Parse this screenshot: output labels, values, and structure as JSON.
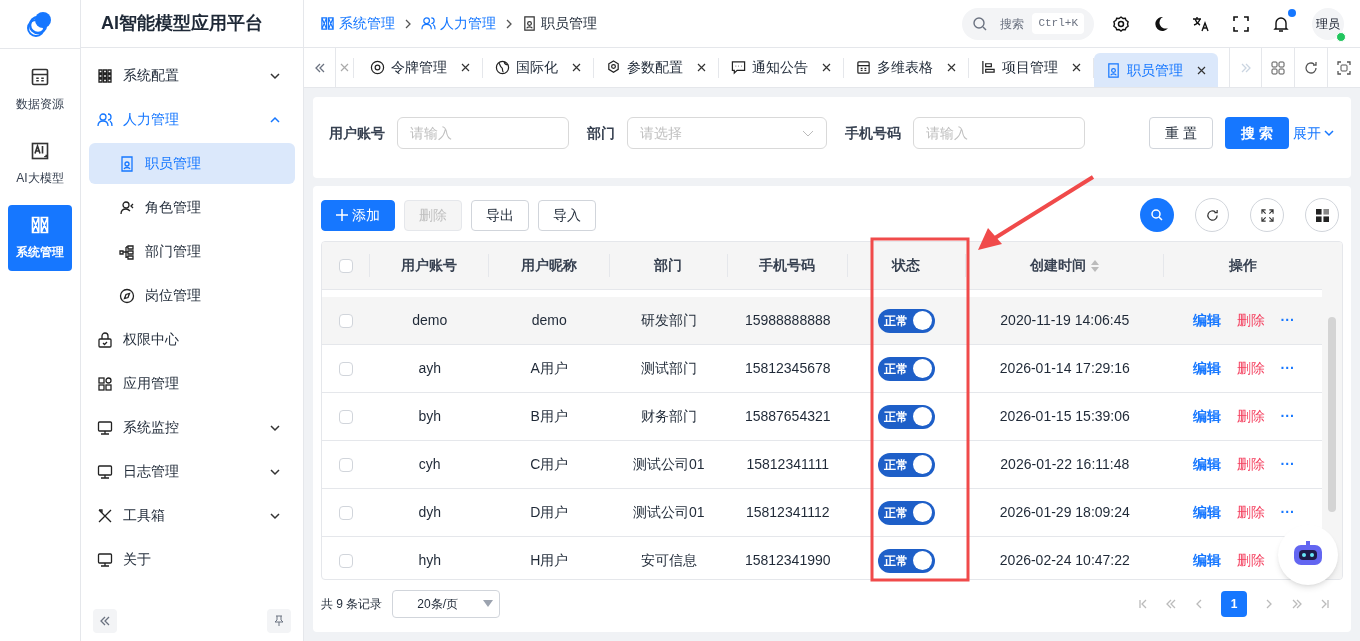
{
  "app": {
    "title": "AI智能模型应用平台"
  },
  "rail": [
    {
      "label": "数据资源",
      "selected": false
    },
    {
      "label": "AI大模型",
      "selected": false
    },
    {
      "label": "系统管理",
      "selected": true
    }
  ],
  "sidebar": {
    "items": [
      {
        "label": "系统配置",
        "expanded": false,
        "selected": false
      },
      {
        "label": "人力管理",
        "expanded": true,
        "selected": false,
        "children": [
          {
            "label": "职员管理",
            "selected": true
          },
          {
            "label": "角色管理",
            "selected": false
          },
          {
            "label": "部门管理",
            "selected": false
          },
          {
            "label": "岗位管理",
            "selected": false
          }
        ]
      },
      {
        "label": "权限中心",
        "selected": false
      },
      {
        "label": "应用管理",
        "selected": false
      },
      {
        "label": "系统监控",
        "expanded": false,
        "selected": false
      },
      {
        "label": "日志管理",
        "expanded": false,
        "selected": false
      },
      {
        "label": "工具箱",
        "expanded": false,
        "selected": false
      },
      {
        "label": "关于",
        "selected": false
      }
    ]
  },
  "breadcrumb": [
    {
      "label": "系统管理",
      "current": false
    },
    {
      "label": "人力管理",
      "current": false
    },
    {
      "label": "职员管理",
      "current": true
    }
  ],
  "header": {
    "search_label": "搜索",
    "shortcut": "Ctrl+K",
    "avatar": "理员",
    "notification_dot": true,
    "online": true
  },
  "tabs": [
    {
      "label": "令牌管理",
      "selected": false
    },
    {
      "label": "国际化",
      "selected": false
    },
    {
      "label": "参数配置",
      "selected": false
    },
    {
      "label": "通知公告",
      "selected": false
    },
    {
      "label": "多维表格",
      "selected": false
    },
    {
      "label": "项目管理",
      "selected": false
    },
    {
      "label": "职员管理",
      "selected": true
    }
  ],
  "filters": [
    {
      "label": "用户账号",
      "kind": "input",
      "placeholder": "请输入"
    },
    {
      "label": "部门",
      "kind": "select",
      "placeholder": "请选择"
    },
    {
      "label": "手机号码",
      "kind": "input",
      "placeholder": "请输入"
    }
  ],
  "filter_buttons": {
    "reset": "重 置",
    "search": "搜 索",
    "expand": "展开"
  },
  "toolbar": [
    {
      "label": "添加",
      "kind": "primary",
      "disabled": false
    },
    {
      "label": "删除",
      "kind": "default",
      "disabled": true
    },
    {
      "label": "导出",
      "kind": "default",
      "disabled": false
    },
    {
      "label": "导入",
      "kind": "default",
      "disabled": false
    }
  ],
  "table": {
    "columns": [
      "用户账号",
      "用户昵称",
      "部门",
      "手机号码",
      "状态",
      "创建时间",
      "操作"
    ],
    "header_checked": false,
    "rows": [
      {
        "account": "demo",
        "nickname": "demo",
        "dept": "研发部门",
        "phone": "15988888888",
        "status": "正常",
        "on": true,
        "created": "2020-11-19 14:06:45",
        "checked": false,
        "actions": [
          "编辑",
          "删除",
          "···"
        ]
      },
      {
        "account": "ayh",
        "nickname": "A用户",
        "dept": "测试部门",
        "phone": "15812345678",
        "status": "正常",
        "on": true,
        "created": "2026-01-14 17:29:16",
        "checked": false,
        "actions": [
          "编辑",
          "删除",
          "···"
        ]
      },
      {
        "account": "byh",
        "nickname": "B用户",
        "dept": "财务部门",
        "phone": "15887654321",
        "status": "正常",
        "on": true,
        "created": "2026-01-15 15:39:06",
        "checked": false,
        "actions": [
          "编辑",
          "删除",
          "···"
        ]
      },
      {
        "account": "cyh",
        "nickname": "C用户",
        "dept": "测试公司01",
        "phone": "15812341111",
        "status": "正常",
        "on": true,
        "created": "2026-01-22 16:11:48",
        "checked": false,
        "actions": [
          "编辑",
          "删除",
          "···"
        ]
      },
      {
        "account": "dyh",
        "nickname": "D用户",
        "dept": "测试公司01",
        "phone": "15812341112",
        "status": "正常",
        "on": true,
        "created": "2026-01-29 18:09:24",
        "checked": false,
        "actions": [
          "编辑",
          "删除",
          "···"
        ]
      },
      {
        "account": "hyh",
        "nickname": "H用户",
        "dept": "安可信息",
        "phone": "15812341990",
        "status": "正常",
        "on": true,
        "created": "2026-02-24 10:47:22",
        "checked": false,
        "actions": [
          "编辑",
          "删除"
        ]
      }
    ]
  },
  "pagination": {
    "total": "共 9 条记录",
    "page_size": "20条/页",
    "pages": [
      {
        "label": "1",
        "selected": true
      }
    ]
  }
}
